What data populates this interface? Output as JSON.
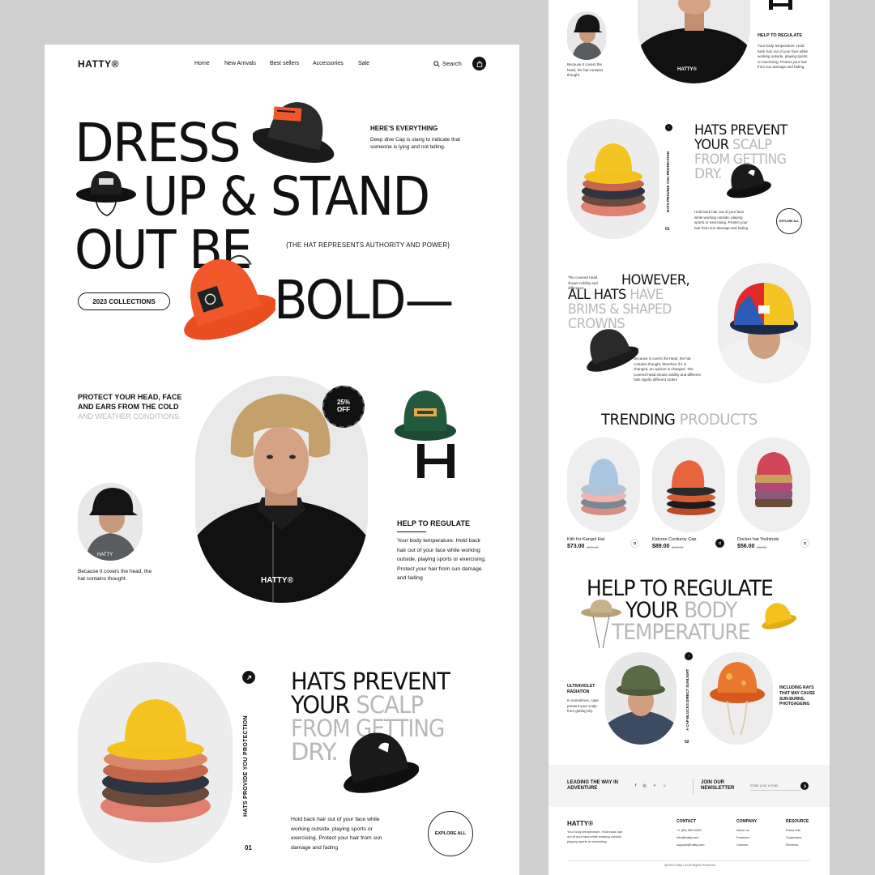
{
  "nav": {
    "logo": "HATTY®",
    "links": [
      "Home",
      "New Arrivals",
      "Best sellers",
      "Accessories",
      "Sale"
    ],
    "search_label": "Search"
  },
  "hero": {
    "line1": "DRESS",
    "line2": "UP & STAND",
    "line3": "OUT BE",
    "line4": "BOLD—",
    "heres_everything_title": "HERE'S EVERYTHING",
    "heres_everything_text": "Deep dive Cap is slang to indicate that someone is lying and not telling.",
    "authority": "{THE HAT REPRESENTS AUTHORITY AND POWER}",
    "collections_button": "2023 COLLECTIONS"
  },
  "protect": {
    "title_dark": "PROTECT YOUR HEAD, FACE AND EARS FROM THE COLD",
    "title_grey": "AND WEATHER CONDITIONS.",
    "caption": "Because it covers the head, the hat contains thought.",
    "discount_badge": "25% OFF",
    "model_logo": "HATTY®",
    "help_title": "HELP TO REGULATE",
    "help_text": "Your body temperature. Hold back hair out of your face while working outside, playing sports or exercising. Protect your hair from sun damage and fading"
  },
  "prevent": {
    "vertical": "HATS PROVIDE YOU PROTECTION",
    "number": "01",
    "line1": "HATS PREVENT",
    "line2_dark": "YOUR",
    "line2_grey": "SCALP",
    "line3": "FROM GETTING",
    "line4": "DRY.",
    "text": "Hold back hair out of your face while working outside, playing sports or exercising. Protect your hair from sun damage and fading",
    "explore_button": "EXPLORE ALL"
  },
  "right": {
    "top_caption": "Because it covers the head, the hat contains thought.",
    "top_help_title": "HELP TO REGULATE",
    "top_help_text": "Your body temperature. Hold back hair out of your face while working outside, playing sports or exercising. Protect your hair from sun damage and fading",
    "top_model_logo": "HATTY®",
    "prevent_vertical": "HATS PROVIDE YOU PROTECTION",
    "prevent_number": "01",
    "prevent_l1": "HATS PREVENT",
    "prevent_l2_dark": "YOUR",
    "prevent_l2_grey": "SCALP",
    "prevent_l3": "FROM GETTING",
    "prevent_l4": "DRY.",
    "prevent_text": "Hold back hair out of your face while working outside, playing sports or exercising. Protect your hair from sun damage and fading",
    "prevent_explore": "EXPLORE ALL",
    "however_small": "The covered head shows nobility and difference.",
    "however_l1": "HOWEVER,",
    "however_l2_dark": "ALL HATS",
    "however_l2_grey": "HAVE",
    "however_l3": "BRIMS & SHAPED",
    "however_l4": "CROWNS",
    "however_text": "Because it covers the head, the hat contains thought, therefore if it is changed, an opinion is changed. The covered head shows nobility and different hats signify different orders",
    "trending_dark": "TRENDING",
    "trending_grey": "PRODUCTS",
    "products": [
      {
        "name": "Kith for Kangol Hat",
        "price": "$73.00",
        "old_price": "$100.00"
      },
      {
        "name": "Kidcore Corduroy Cap",
        "price": "$89.00",
        "old_price": "$120.00"
      },
      {
        "name": "Docker hat Yoshinoki",
        "price": "$56.00",
        "old_price": "$80.00"
      }
    ],
    "regulate_l1": "HELP TO REGULATE",
    "regulate_l2_dark": "YOUR",
    "regulate_l2_grey": "BODY",
    "regulate_l3": "TEMPERATURE",
    "uv_title": "ULTRAVIOLET RADIATION",
    "uv_text": "In sometimes, caps prevent your scalp from getting dry.",
    "cap_vertical": "A CAP BLOCKS DIRECT SUNLIGHT",
    "cap_number": "02",
    "rays_text": "INCLUDING RAYS THAT MAY CAUSE SUN-BURNS, PHOTOAGEING",
    "leading": "LEADING THE WAY IN ADVENTURE",
    "join": "JOIN OUR NEWSLETTER",
    "email_placeholder": "Enter your e-mail",
    "footer_logo": "HATTY®",
    "footer_text": "Your body temperature. Hold back hair out of your face while working outside, playing sports or exercising.",
    "footer_cols": [
      {
        "title": "CONTACT",
        "items": [
          "+1 (85) 655 0390",
          "info@hatty.com",
          "support@hatty.com"
        ]
      },
      {
        "title": "COMPANY",
        "items": [
          "About us",
          "Features",
          "Careers"
        ]
      },
      {
        "title": "RESOURCE",
        "items": [
          "Press Kits",
          "Customers",
          "Reviews"
        ]
      }
    ],
    "copyright": "@2023 Hatty Ltd All Rights Reserved"
  },
  "colors": {
    "page_bg": "#cfcfcf",
    "card_bg": "#ffffff",
    "text": "#111111",
    "grey_text": "#b8b8b8",
    "accent_orange": "#f0582a",
    "yellow": "#f3c21d"
  }
}
